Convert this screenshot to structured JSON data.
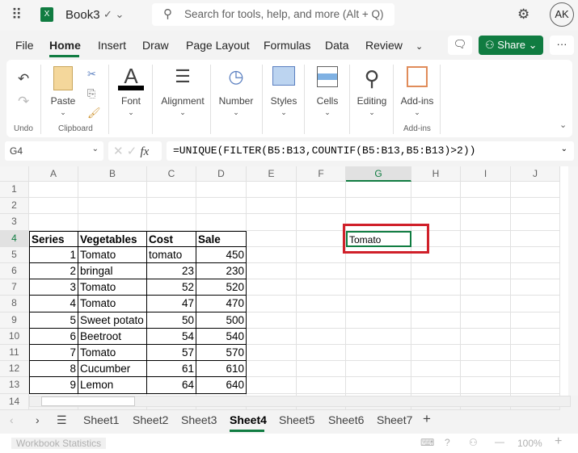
{
  "app": {
    "title": "Book3",
    "search_placeholder": "Search for tools, help, and more (Alt + Q)",
    "avatar": "AK",
    "brand_color": "#107c41"
  },
  "menu": {
    "tabs": [
      "File",
      "Home",
      "Insert",
      "Draw",
      "Page Layout",
      "Formulas",
      "Data",
      "Review"
    ],
    "active": "Home",
    "share": "Share"
  },
  "ribbon": {
    "undo": "Undo",
    "paste": "Paste",
    "clipboard": "Clipboard",
    "font": "Font",
    "alignment": "Alignment",
    "number": "Number",
    "styles": "Styles",
    "cells": "Cells",
    "editing": "Editing",
    "addins": "Add-ins",
    "addins_group": "Add-ins"
  },
  "formula_bar": {
    "name_box": "G4",
    "fx": "fx",
    "formula": "=UNIQUE(FILTER(B5:B13,COUNTIF(B5:B13,B5:B13)>2))"
  },
  "grid": {
    "columns": [
      "A",
      "B",
      "C",
      "D",
      "E",
      "F",
      "G",
      "H",
      "I",
      "J"
    ],
    "rows": [
      "1",
      "2",
      "3",
      "4",
      "5",
      "6",
      "7",
      "8",
      "9",
      "10",
      "11",
      "12",
      "13",
      "14"
    ],
    "headers": [
      "Series",
      "Vegetables",
      "Cost",
      "Sale"
    ],
    "data": [
      [
        "1",
        "Tomato",
        "tomato",
        "450"
      ],
      [
        "2",
        "bringal",
        "23",
        "230"
      ],
      [
        "3",
        "Tomato",
        "52",
        "520"
      ],
      [
        "4",
        "Tomato",
        "47",
        "470"
      ],
      [
        "5",
        "Sweet potato",
        "50",
        "500"
      ],
      [
        "6",
        "Beetroot",
        "54",
        "540"
      ],
      [
        "7",
        "Tomato",
        "57",
        "570"
      ],
      [
        "8",
        "Cucumber",
        "61",
        "610"
      ],
      [
        "9",
        "Lemon",
        "64",
        "640"
      ]
    ],
    "result": "Tomato"
  },
  "sheets": {
    "tabs": [
      "Sheet1",
      "Sheet2",
      "Sheet3",
      "Sheet4",
      "Sheet5",
      "Sheet6",
      "Sheet7"
    ],
    "active": "Sheet4"
  },
  "status": {
    "stats": "Workbook Statistics",
    "zoom": "100%"
  }
}
